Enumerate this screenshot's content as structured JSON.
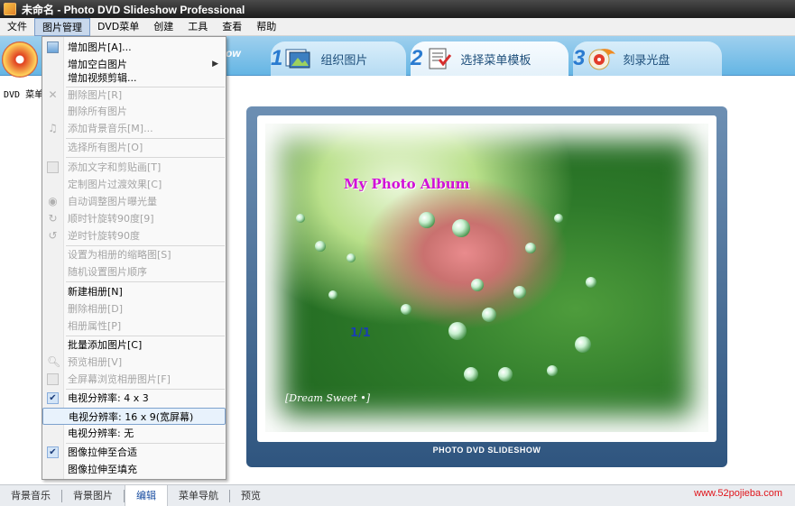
{
  "window": {
    "title": "未命名 - Photo DVD Slideshow Professional"
  },
  "menubar": {
    "items": [
      "文件",
      "图片管理",
      "DVD菜单",
      "创建",
      "工具",
      "查看",
      "帮助"
    ]
  },
  "steps": {
    "logo_text": "ow",
    "items": [
      {
        "num": "1",
        "label": "组织图片",
        "icon": "photo-organize-icon"
      },
      {
        "num": "2",
        "label": "选择菜单模板",
        "icon": "menu-template-icon"
      },
      {
        "num": "3",
        "label": "刻录光盘",
        "icon": "burn-disc-icon"
      }
    ]
  },
  "left_label": "DVD 菜单",
  "image_menu": {
    "items": [
      {
        "label": "增加图片[A]...",
        "enabled": true,
        "icon": "add-image-icon"
      },
      {
        "label": "增加空白图片",
        "enabled": true,
        "submenu": true
      },
      {
        "label": "增加视频剪辑...",
        "enabled": true
      },
      {
        "label": "删除图片[R]",
        "enabled": false,
        "icon": "delete-icon"
      },
      {
        "label": "删除所有图片",
        "enabled": false
      },
      {
        "label": "添加背景音乐[M]...",
        "enabled": false,
        "icon": "music-note-icon"
      },
      {
        "label": "选择所有图片[O]",
        "enabled": false
      },
      {
        "label": "添加文字和剪贴画[T]",
        "enabled": false,
        "icon": "text-clipart-icon"
      },
      {
        "label": "定制图片过渡效果[C]",
        "enabled": false
      },
      {
        "label": "自动调整图片曝光量",
        "enabled": false,
        "icon": "exposure-icon"
      },
      {
        "label": "顺时针旋转90度[9]",
        "enabled": false,
        "icon": "rotate-cw-icon"
      },
      {
        "label": "逆时针旋转90度",
        "enabled": false,
        "icon": "rotate-ccw-icon"
      },
      {
        "label": "设置为相册的缩略图[S]",
        "enabled": false
      },
      {
        "label": "随机设置图片顺序",
        "enabled": false
      },
      {
        "label": "新建相册[N]",
        "enabled": true
      },
      {
        "label": "删除相册[D]",
        "enabled": false
      },
      {
        "label": "相册属性[P]",
        "enabled": false
      },
      {
        "label": "批量添加图片[C]",
        "enabled": true
      },
      {
        "label": "预览相册[V]",
        "enabled": false,
        "icon": "preview-magnifier-icon"
      },
      {
        "label": "全屏幕浏览相册图片[F]",
        "enabled": false,
        "icon": "fullscreen-icon"
      },
      {
        "label": "电视分辨率:  4 x 3",
        "enabled": true,
        "checked": true
      },
      {
        "label": "电视分辨率: 16 x 9(宽屏幕)",
        "enabled": true,
        "highlighted": true
      },
      {
        "label": "电视分辨率: 无",
        "enabled": true
      },
      {
        "label": "图像拉伸至合适",
        "enabled": true,
        "checked": true
      },
      {
        "label": "图像拉伸至填充",
        "enabled": true
      }
    ]
  },
  "preview": {
    "album_title": "My Photo Album",
    "page_indicator": "1/1",
    "signature": "[Dream Sweet •]",
    "brand": "PHOTO DVD SLIDESHOW"
  },
  "bottom_tabs": {
    "items": [
      "背景音乐",
      "背景图片",
      "编辑",
      "菜单导航",
      "预览"
    ],
    "active_index": 2
  },
  "watermark": "www.52pojieba.com"
}
